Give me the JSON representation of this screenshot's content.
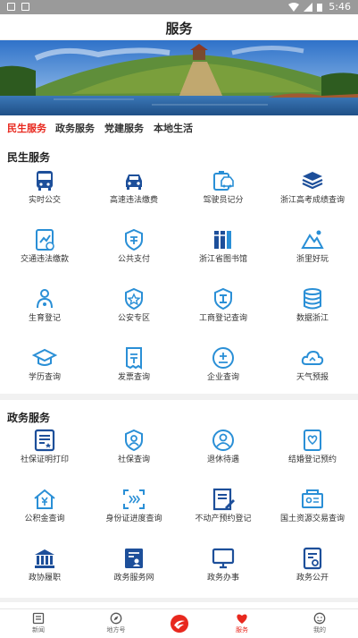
{
  "status": {
    "time": "5:46"
  },
  "header": {
    "title": "服务"
  },
  "tabs": [
    {
      "label": "民生服务",
      "active": true
    },
    {
      "label": "政务服务",
      "active": false
    },
    {
      "label": "党建服务",
      "active": false
    },
    {
      "label": "本地生活",
      "active": false
    }
  ],
  "sections": {
    "livelihood": {
      "title": "民生服务",
      "items": [
        {
          "label": "实时公交",
          "icon": "bus-icon"
        },
        {
          "label": "高速违法缴费",
          "icon": "car-icon"
        },
        {
          "label": "驾驶员记分",
          "icon": "driver-score-icon"
        },
        {
          "label": "浙江高考成绩查询",
          "icon": "layers-icon"
        },
        {
          "label": "交通违法缴款",
          "icon": "traffic-fine-icon"
        },
        {
          "label": "公共支付",
          "icon": "payment-icon"
        },
        {
          "label": "浙江省图书馆",
          "icon": "library-icon"
        },
        {
          "label": "浙里好玩",
          "icon": "mountain-icon"
        },
        {
          "label": "生育登记",
          "icon": "birth-icon"
        },
        {
          "label": "公安专区",
          "icon": "police-badge-icon"
        },
        {
          "label": "工商登记查询",
          "icon": "business-shield-icon"
        },
        {
          "label": "数据浙江",
          "icon": "database-icon"
        },
        {
          "label": "学历查询",
          "icon": "graduation-cap-icon"
        },
        {
          "label": "发票查询",
          "icon": "invoice-icon"
        },
        {
          "label": "企业查询",
          "icon": "enterprise-icon"
        },
        {
          "label": "天气预报",
          "icon": "weather-icon"
        }
      ]
    },
    "government": {
      "title": "政务服务",
      "items": [
        {
          "label": "社保证明打印",
          "icon": "print-proof-icon"
        },
        {
          "label": "社保查询",
          "icon": "social-security-icon"
        },
        {
          "label": "退休待遇",
          "icon": "retirement-icon"
        },
        {
          "label": "结婚登记预约",
          "icon": "marriage-icon"
        },
        {
          "label": "公积金查询",
          "icon": "housing-fund-icon"
        },
        {
          "label": "身份证进度查询",
          "icon": "id-card-progress-icon"
        },
        {
          "label": "不动产预约登记",
          "icon": "real-estate-icon"
        },
        {
          "label": "国土资源交易查询",
          "icon": "land-resource-icon"
        },
        {
          "label": "政协履职",
          "icon": "congress-icon"
        },
        {
          "label": "政务服务网",
          "icon": "gov-portal-icon"
        },
        {
          "label": "政务办事",
          "icon": "monitor-icon"
        },
        {
          "label": "政务公开",
          "icon": "gov-open-icon"
        }
      ]
    }
  },
  "bottom_nav": [
    {
      "label": "新闻",
      "icon": "news-icon",
      "active": false
    },
    {
      "label": "地方号",
      "icon": "compass-icon",
      "active": false
    },
    {
      "label": "",
      "icon": "logo-icon",
      "active": false
    },
    {
      "label": "服务",
      "icon": "heart-service-icon",
      "active": true
    },
    {
      "label": "我的",
      "icon": "profile-icon",
      "active": false
    }
  ],
  "colors": {
    "accent": "#e8281e",
    "icon_blue": "#2a8fd6",
    "icon_dark": "#1d4f9a"
  }
}
